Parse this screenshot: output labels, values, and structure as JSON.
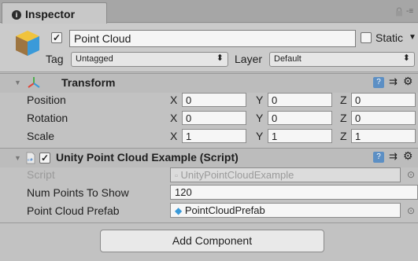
{
  "tab": {
    "label": "Inspector",
    "info_glyph": "i"
  },
  "header": {
    "object_name": "Point Cloud",
    "static_label": "Static",
    "tag_label": "Tag",
    "tag_value": "Untagged",
    "layer_label": "Layer",
    "layer_value": "Default"
  },
  "transform": {
    "title": "Transform",
    "rows": [
      {
        "label": "Position",
        "x": "0",
        "y": "0",
        "z": "0"
      },
      {
        "label": "Rotation",
        "x": "0",
        "y": "0",
        "z": "0"
      },
      {
        "label": "Scale",
        "x": "1",
        "y": "1",
        "z": "1"
      }
    ],
    "axes": {
      "x": "X",
      "y": "Y",
      "z": "Z"
    }
  },
  "script_component": {
    "title": "Unity Point Cloud Example (Script)",
    "script_label": "Script",
    "script_value": "UnityPointCloudExample",
    "num_points_label": "Num Points To Show",
    "num_points_value": "120",
    "prefab_label": "Point Cloud Prefab",
    "prefab_value": "PointCloudPrefab"
  },
  "add_component_label": "Add Component",
  "icons": [
    "info-icon",
    "lock-icon",
    "menu-icon",
    "cube-icon",
    "transform-icon",
    "script-icon",
    "help-icon",
    "preset-icon",
    "gear-icon",
    "object-picker-icon",
    "prefab-icon"
  ],
  "colors": {
    "panel": "#c2c2c2",
    "header": "#cbcbcb",
    "field": "#f6f6f6",
    "prefab_blue": "#3a9ad9"
  }
}
